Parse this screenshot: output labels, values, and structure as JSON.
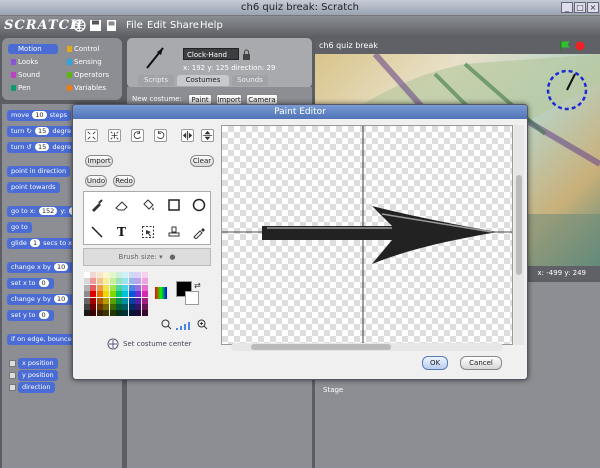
{
  "window": {
    "title": "ch6 quiz break: Scratch"
  },
  "app": {
    "logo": "SCRATCH"
  },
  "menu": [
    "File",
    "Edit",
    "Share",
    "Help"
  ],
  "categories": [
    {
      "label": "Motion",
      "color": "#4a6cd4"
    },
    {
      "label": "Control",
      "color": "#e1a91a"
    },
    {
      "label": "Looks",
      "color": "#8a55d7"
    },
    {
      "label": "Sensing",
      "color": "#2ca5e2"
    },
    {
      "label": "Sound",
      "color": "#bb42c3"
    },
    {
      "label": "Operators",
      "color": "#5cb712"
    },
    {
      "label": "Pen",
      "color": "#0e9a6c"
    },
    {
      "label": "Variables",
      "color": "#ee7d16"
    }
  ],
  "blocks": {
    "move": "move",
    "move_num": "10",
    "move_suffix": "steps",
    "turn": "turn",
    "turn_num": "15",
    "turn_suffix": "degre",
    "turn2": "turn",
    "turn2_num": "15",
    "turn2_suffix": "degre",
    "point_dir": "point in direction",
    "point_towards": "point towards",
    "goto_xy": "go to x:",
    "goto_x": "152",
    "goto_y_label": "y:",
    "goto_y": "13",
    "goto": "go to",
    "glide": "glide",
    "glide_num": "1",
    "glide_suffix": "secs to x:",
    "change_x": "change x by",
    "change_x_num": "10",
    "set_x": "set x to",
    "set_x_num": "0",
    "change_y": "change y by",
    "change_y_num": "10",
    "set_y": "set y to",
    "set_y_num": "0",
    "bounce": "if on edge, bounce",
    "x_pos": "x position",
    "y_pos": "y position",
    "direction": "direction"
  },
  "sprite": {
    "name": "Clock-Hand",
    "x_label": "x:",
    "x": "192",
    "y_label": "y:",
    "y": "125",
    "dir_label": "direction:",
    "dir": "29"
  },
  "tabs": [
    "Scripts",
    "Costumes",
    "Sounds"
  ],
  "costume_bar": {
    "label": "New costume:",
    "paint": "Paint",
    "import": "Import",
    "camera": "Camera"
  },
  "stage": {
    "title": "ch6 quiz break",
    "mouse_x_label": "x:",
    "mouse_x": "-499",
    "mouse_y_label": "y:",
    "mouse_y": "249",
    "label": "Stage"
  },
  "paint_editor": {
    "title": "Paint Editor",
    "import": "Import",
    "clear": "Clear",
    "undo": "Undo",
    "redo": "Redo",
    "brush_size": "Brush size:",
    "set_center": "Set costume center",
    "ok": "OK",
    "cancel": "Cancel"
  },
  "swatches": [
    "#ffffff",
    "#f4d6d6",
    "#f7e6cc",
    "#fbf6cc",
    "#e3f6cc",
    "#ccf0dd",
    "#ccf2f6",
    "#ccdaf6",
    "#ded0f6",
    "#f6d0ee",
    "#d8d8d8",
    "#f19a9a",
    "#f3c48f",
    "#f7ee99",
    "#c7ee99",
    "#99e2bb",
    "#99e4ee",
    "#99b6ee",
    "#bca3ee",
    "#eea3de",
    "#b3b3b3",
    "#e55b5b",
    "#ee9c4a",
    "#f2e24a",
    "#a4e34a",
    "#4ad39a",
    "#4ad4e3",
    "#4a86e3",
    "#9a6de3",
    "#e36dc8",
    "#8c8c8c",
    "#dd0000",
    "#e86d00",
    "#efd800",
    "#7fd800",
    "#00c16e",
    "#00c2d8",
    "#0059d8",
    "#6f2ad8",
    "#d82aae",
    "#666666",
    "#a30000",
    "#ad5000",
    "#b19f00",
    "#5e9f00",
    "#008e51",
    "#008f9f",
    "#00419f",
    "#511f9f",
    "#9f1f80",
    "#404040",
    "#6a0000",
    "#703400",
    "#736700",
    "#3d6700",
    "#005c34",
    "#005d67",
    "#002a67",
    "#351467",
    "#671453",
    "#1a1a1a",
    "#370000",
    "#3a1b00",
    "#3b3500",
    "#203500",
    "#003019",
    "#003035",
    "#001635",
    "#1b0a35",
    "#350a2b"
  ]
}
